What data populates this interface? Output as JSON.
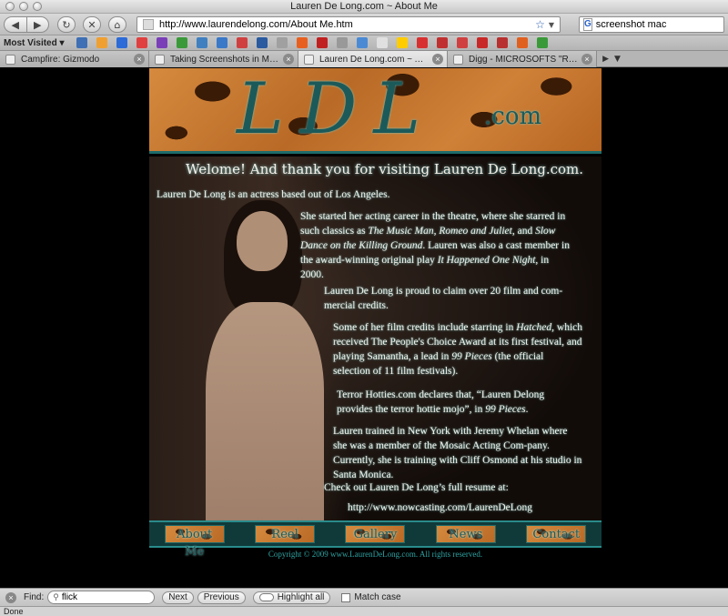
{
  "window": {
    "title": "Lauren De Long.com ~ About Me"
  },
  "navigation": {
    "back_icon": "back-arrow-icon",
    "forward_icon": "forward-arrow-icon",
    "url": "http://www.laurendelong.com/About Me.htm",
    "search_value": "screenshot mac"
  },
  "bookmarks": {
    "most_visited_label": "Most Visited ▾",
    "icon_colors": [
      "#3f6fb5",
      "#f0a030",
      "#2c6bd8",
      "#e04040",
      "#7a3fb8",
      "#3a9a3a",
      "#4080c0",
      "#3a78c8",
      "#d04040",
      "#2a5aa0",
      "#a0a0a0",
      "#e86020",
      "#c02020",
      "#999",
      "#4a8ad4",
      "#e0e0e0",
      "#ffcc00",
      "#d83030",
      "#c03030",
      "#d04040",
      "#c82828",
      "#b83030",
      "#e06020",
      "#3a9a3a"
    ]
  },
  "tabs": [
    {
      "label": "Campfire: Gizmodo",
      "active": false
    },
    {
      "label": "Taking Screenshots in Mac OS ...",
      "active": false
    },
    {
      "label": "Lauren De Long.com ~ About Me",
      "active": true
    },
    {
      "label": "Digg - MICROSOFTS \"REGULAR...",
      "active": false
    }
  ],
  "site": {
    "logo_letters": "LDL",
    "logo_suffix": ".com",
    "welcome": "Welome! And thank you for visiting Lauren De Long.com.",
    "intro": "Lauren De Long is an actress based out of Los Angeles.",
    "paragraphs": {
      "p1a": "She started her acting career in the theatre, where she starred in such classics as ",
      "p1_show1": "The Music Man",
      "p1b": ", ",
      "p1_show2": "Romeo and Juliet",
      "p1c": ", and ",
      "p1_show3": "Slow Dance on the Killing Ground",
      "p1d": ". Lauren was also a cast member in the award-winning original play ",
      "p1_show4": "It Happened One Night",
      "p1e": ", in 2000.",
      "p2": "Lauren De Long is proud to claim over 20 film and com-mercial credits.",
      "p3a": "Some of her film credits include starring in ",
      "p3_film1": "Hatched",
      "p3b": ", which received The People's Choice Award at its first festival, and playing Samantha, a lead in ",
      "p3_film2": "99 Pieces",
      "p3c": " (the official selection of 11 film festivals).",
      "p4a": "Terror Hotties.com declares that, “Lauren Delong provides the terror hottie mojo”, in ",
      "p4_film": "99 Pieces",
      "p4b": ".",
      "p5": "Lauren trained in New York with Jeremy Whelan where she was a member of the Mosaic Acting Com-pany. Currently, she is training with Cliff Osmond at his studio in Santa Monica.",
      "p6": "Check out Lauren De Long’s full resume at:",
      "p7": "http://www.nowcasting.com/LaurenDeLong"
    },
    "nav": [
      "About Me",
      "Reel",
      "Gallery",
      "News",
      "Contact"
    ],
    "copyright": "Copyright © 2009 www.LaurenDeLong.com. All rights reserved."
  },
  "findbar": {
    "label": "Find:",
    "query": "flick",
    "next_label": "Next",
    "previous_label": "Previous",
    "highlight_label": "Highlight all",
    "matchcase_label": "Match case"
  },
  "status": {
    "text": "Done"
  }
}
